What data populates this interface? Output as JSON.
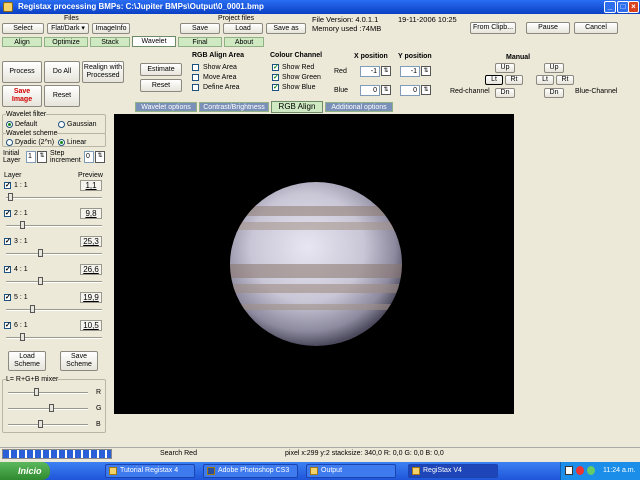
{
  "window": {
    "title": "Registax processing BMPs: C:\\Jupiter BMPs\\Output\\0_0001.bmp"
  },
  "files": {
    "header": "Files",
    "select": "Select",
    "flatdark": "Flat/Dark",
    "imageinfo": "ImageInfo"
  },
  "project": {
    "header": "Project files",
    "save": "Save",
    "load": "Load",
    "save_as": "Save as"
  },
  "info": {
    "file_version": "File Version: 4.0.1.1",
    "date": "19-11-2006 10:25",
    "memory": "Memory used :74MB"
  },
  "top_buttons": {
    "from_clipboard": "From Clipb...",
    "pause": "Pause",
    "cancel": "Cancel"
  },
  "main_tabs": [
    "Align",
    "Optimize",
    "Stack",
    "Wavelet",
    "Final",
    "About"
  ],
  "actions": {
    "process": "Process",
    "do_all": "Do All",
    "realign": "Realign with Processed",
    "save_image": "Save Image",
    "reset": "Reset"
  },
  "rgb_align": {
    "estimate": "Estimate",
    "reset": "Reset",
    "area_header": "RGB Align Area",
    "show_area": "Show Area",
    "move_area": "Move Area",
    "define_area": "Define Area",
    "colour_header": "Colour Channel",
    "show_red": "Show Red",
    "show_green": "Show Green",
    "show_blue": "Show Blue",
    "xpos_header": "X position",
    "ypos_header": "Y position",
    "red_label": "Red",
    "blue_label": "Blue",
    "red_x": "-1",
    "red_y": "-1",
    "blue_x": "0",
    "blue_y": "0",
    "manual_header": "Manual",
    "red_channel": "Red-channel",
    "blue_channel": "Blue-Channel",
    "up": "Up",
    "lt": "Lt",
    "rt": "Rt",
    "dn": "Dn"
  },
  "sub_tabs": [
    "Wavelet options",
    "Contrast/Brightness",
    "RGB Align",
    "Additional options"
  ],
  "wavelet": {
    "filter_header": "Wavelet filter",
    "default": "Default",
    "gaussian": "Gaussian",
    "scheme_header": "Wavelet scheme",
    "dyadic": "Dyadic (2^n)",
    "linear": "Linear",
    "initial_layer": "Initial Layer",
    "initial_value": "1",
    "step_increment": "Step increment",
    "step_value": "0",
    "layer_header": "Layer",
    "preview_header": "Preview",
    "layers": [
      {
        "label": "1 : 1",
        "value": "1,1",
        "pos": 0.02
      },
      {
        "label": "2 : 1",
        "value": "9,8",
        "pos": 0.15
      },
      {
        "label": "3 : 1",
        "value": "25,3",
        "pos": 0.35
      },
      {
        "label": "4 : 1",
        "value": "26,6",
        "pos": 0.36
      },
      {
        "label": "5 : 1",
        "value": "19,9",
        "pos": 0.27
      },
      {
        "label": "6 : 1",
        "value": "10,5",
        "pos": 0.15
      }
    ],
    "load_scheme": "Load Scheme",
    "save_scheme": "Save Scheme",
    "mixer_header": "L= R+G+B mixer",
    "mixer": [
      {
        "label": "R",
        "pos": 0.35
      },
      {
        "label": "G",
        "pos": 0.55
      },
      {
        "label": "B",
        "pos": 0.4
      }
    ]
  },
  "status": {
    "search": "Search Red",
    "pixel": "pixel x:299 y:2 stacksize: 340,0 R: 0,0 G: 0,0 B: 0,0"
  },
  "taskbar": {
    "start": "Inicio",
    "items": [
      "Tutorial Registax 4",
      "Adobe Photoshop CS3",
      "Output",
      "RegiStax V4"
    ],
    "clock": "11:24 a.m."
  }
}
